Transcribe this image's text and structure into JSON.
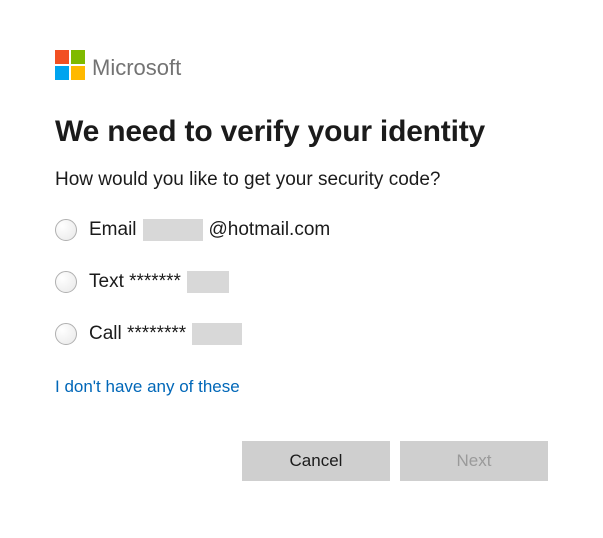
{
  "brand": {
    "name": "Microsoft",
    "logo_colors": {
      "top_left": "#f25022",
      "top_right": "#7fba00",
      "bottom_left": "#00a4ef",
      "bottom_right": "#ffb900"
    }
  },
  "heading": "We need to verify your identity",
  "prompt": "How would you like to get your security code?",
  "options": [
    {
      "id": "email",
      "prefix": "Email",
      "masked": true,
      "suffix": "@hotmail.com"
    },
    {
      "id": "text",
      "prefix": "Text *******",
      "masked": true,
      "suffix": ""
    },
    {
      "id": "call",
      "prefix": "Call ********",
      "masked": true,
      "suffix": ""
    }
  ],
  "alt_link": "I don't have any of these",
  "buttons": {
    "cancel": "Cancel",
    "next": "Next"
  },
  "colors": {
    "link": "#0067b8",
    "button_bg": "#cfcfcf",
    "button_disabled_text": "#9a9a9a"
  }
}
